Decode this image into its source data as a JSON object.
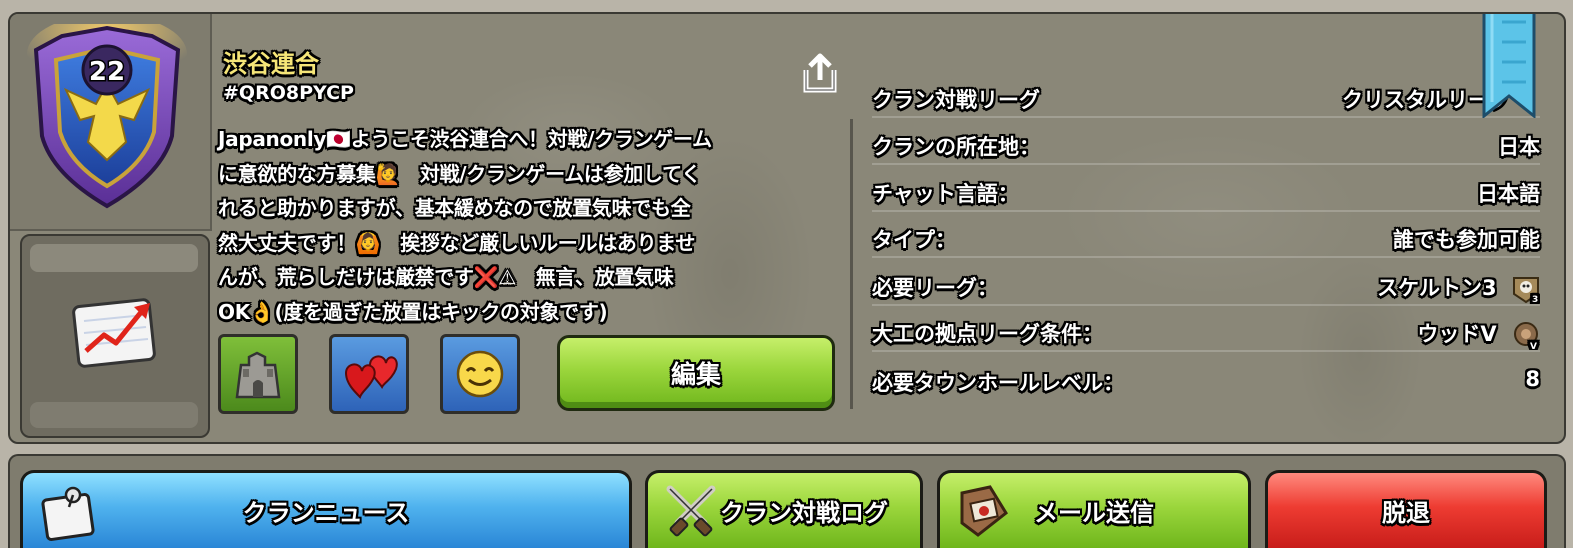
{
  "clan": {
    "level": "22",
    "name": "渋谷連合",
    "tag": "#QRO8PYCP",
    "description": "Japanonly🇯🇵ようこそ渋谷連合へ！対戦/クランゲーム\nに意欲的な方募集🙋　対戦/クランゲームは参加してく\nれると助かりますが、基本緩めなので放置気味でも全\n然大丈夫です！🙆　挨拶など厳しいルールはありませ\nんが、荒らしだけは厳禁です❌⚠　無言、放置気味\nOK👌(度を過ぎた放置はキックの対象です)"
  },
  "icons": {
    "share": "share-icon",
    "history": "clan-history-chart-icon",
    "war_tile": "war-fortress-icon",
    "friendly_tile": "hearts-icon",
    "family_tile": "smiley-icon",
    "ribbon": "bookmark-ribbon-icon",
    "skeleton_league": "skeleton-league-icon",
    "wood_league": "wood-league-icon"
  },
  "actions": {
    "edit": "編集",
    "news": "クランニュース",
    "war_log": "クラン対戦ログ",
    "mail": "メール送信",
    "leave": "脱退"
  },
  "info": {
    "war_league": {
      "label": "クラン対戦リーグ",
      "value": "クリスタルリーグ"
    },
    "location": {
      "label": "クランの所在地：",
      "value": "日本"
    },
    "chat_language": {
      "label": "チャット言語：",
      "value": "日本語"
    },
    "type": {
      "label": "タイプ：",
      "value": "誰でも参加可能"
    },
    "required_league": {
      "label": "必要リーグ：",
      "value": "スケルトン3",
      "icon_number": "3"
    },
    "builder_league": {
      "label": "大工の拠点リーグ条件：",
      "value": "ウッドV",
      "icon_numeral": "V"
    },
    "required_townhall": {
      "label": "必要タウンホールレベル：",
      "value": "8"
    }
  },
  "colors": {
    "clan_name": "#f6e678",
    "green_button": "#9bd63c",
    "blue_button": "#4fb2ee",
    "red_button": "#ee3c32",
    "panel": "#8a8778"
  }
}
